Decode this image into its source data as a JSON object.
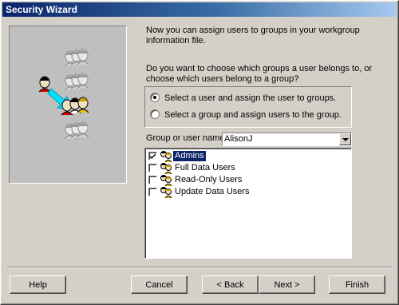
{
  "window": {
    "title": "Security Wizard"
  },
  "intro": "Now you can assign users to groups in your workgroup information file.",
  "question": "Do you want to choose which groups a user belongs to, or choose which users belong to a group?",
  "radio_options": [
    {
      "label": "Select a user and assign the user to groups.",
      "checked": true
    },
    {
      "label": "Select a group and assign users to the group.",
      "checked": false
    }
  ],
  "group_or_user": {
    "label": "Group or user name:",
    "value": "AlisonJ"
  },
  "groups": [
    {
      "name": "Admins",
      "checked": true,
      "selected": true
    },
    {
      "name": "Full Data Users",
      "checked": false,
      "selected": false
    },
    {
      "name": "Read-Only Users",
      "checked": false,
      "selected": false
    },
    {
      "name": "Update Data Users",
      "checked": false,
      "selected": false
    }
  ],
  "buttons": {
    "help": "Help",
    "cancel": "Cancel",
    "back": "< Back",
    "next": "Next >",
    "finish": "Finish"
  }
}
